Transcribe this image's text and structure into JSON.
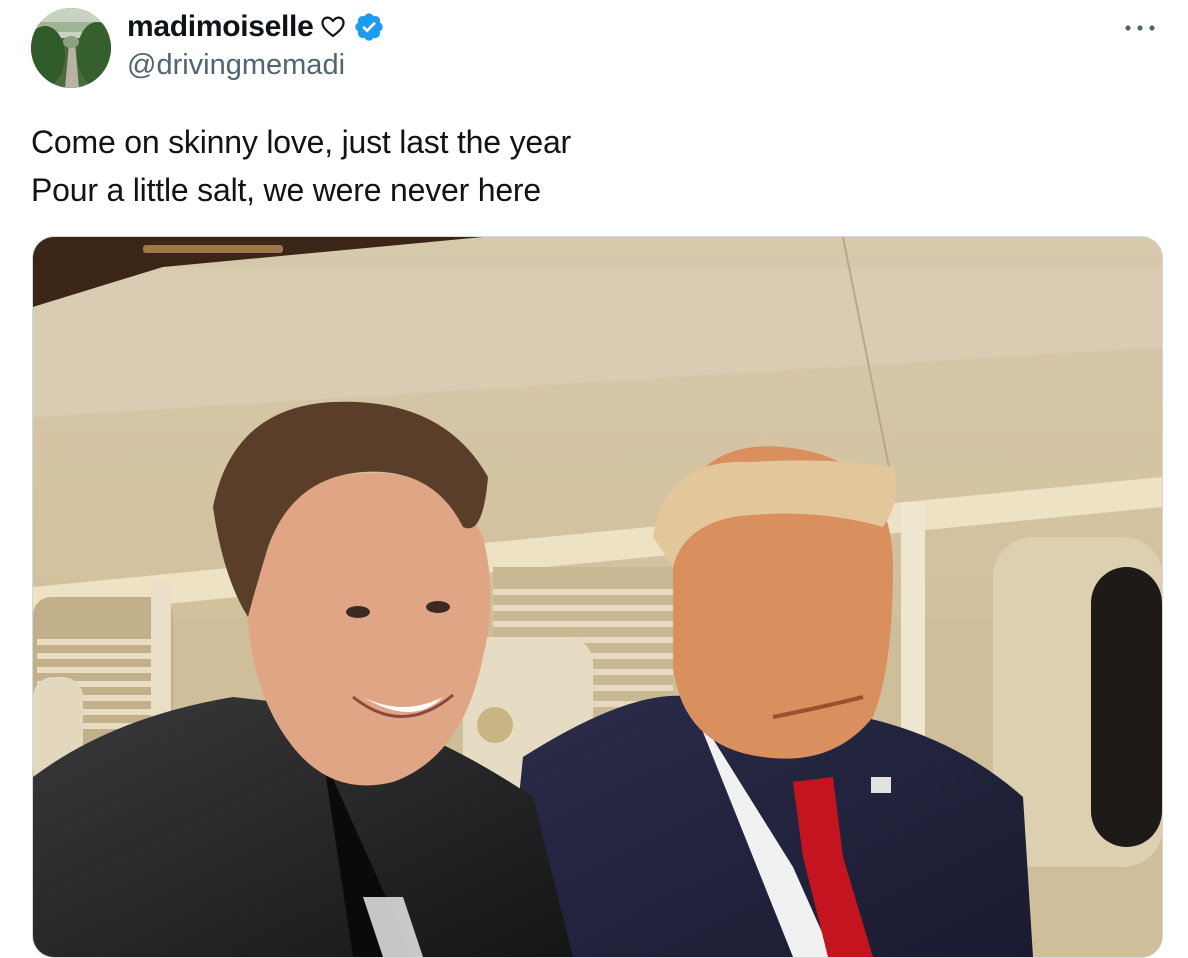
{
  "author": {
    "display_name": "madimoiselle",
    "handle": "@drivingmemadi",
    "verified": true,
    "name_emoji_icon": "heart-outline-icon",
    "verified_icon": "verified-badge-icon",
    "verified_color": "#1d9bf0"
  },
  "menu": {
    "icon": "more-dots-icon"
  },
  "tweet": {
    "lines": [
      "Come on skinny love, just last the year",
      "Pour a little salt, we were never here"
    ]
  },
  "media": {
    "type": "photo"
  },
  "colors": {
    "text_primary": "#0f1419",
    "text_secondary": "#536471",
    "border": "#cfd9de"
  }
}
